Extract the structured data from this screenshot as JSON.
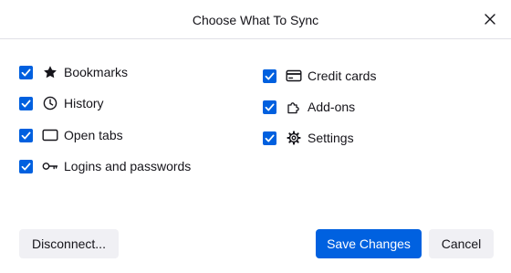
{
  "dialog": {
    "title": "Choose What To Sync"
  },
  "sync_items": [
    {
      "label": "Bookmarks",
      "checked": true,
      "icon": "star-icon"
    },
    {
      "label": "History",
      "checked": true,
      "icon": "clock-icon"
    },
    {
      "label": "Open tabs",
      "checked": true,
      "icon": "tab-icon"
    },
    {
      "label": "Logins and passwords",
      "checked": true,
      "icon": "key-icon"
    },
    {
      "label": "Credit cards",
      "checked": true,
      "icon": "credit-card-icon"
    },
    {
      "label": "Add-ons",
      "checked": true,
      "icon": "puzzle-piece-icon"
    },
    {
      "label": "Settings",
      "checked": true,
      "icon": "gear-icon"
    }
  ],
  "buttons": {
    "disconnect": "Disconnect...",
    "save": "Save Changes",
    "cancel": "Cancel"
  },
  "colors": {
    "accent": "#0060df",
    "primary_button": "#0061e0",
    "secondary_button": "#f0f0f4"
  }
}
